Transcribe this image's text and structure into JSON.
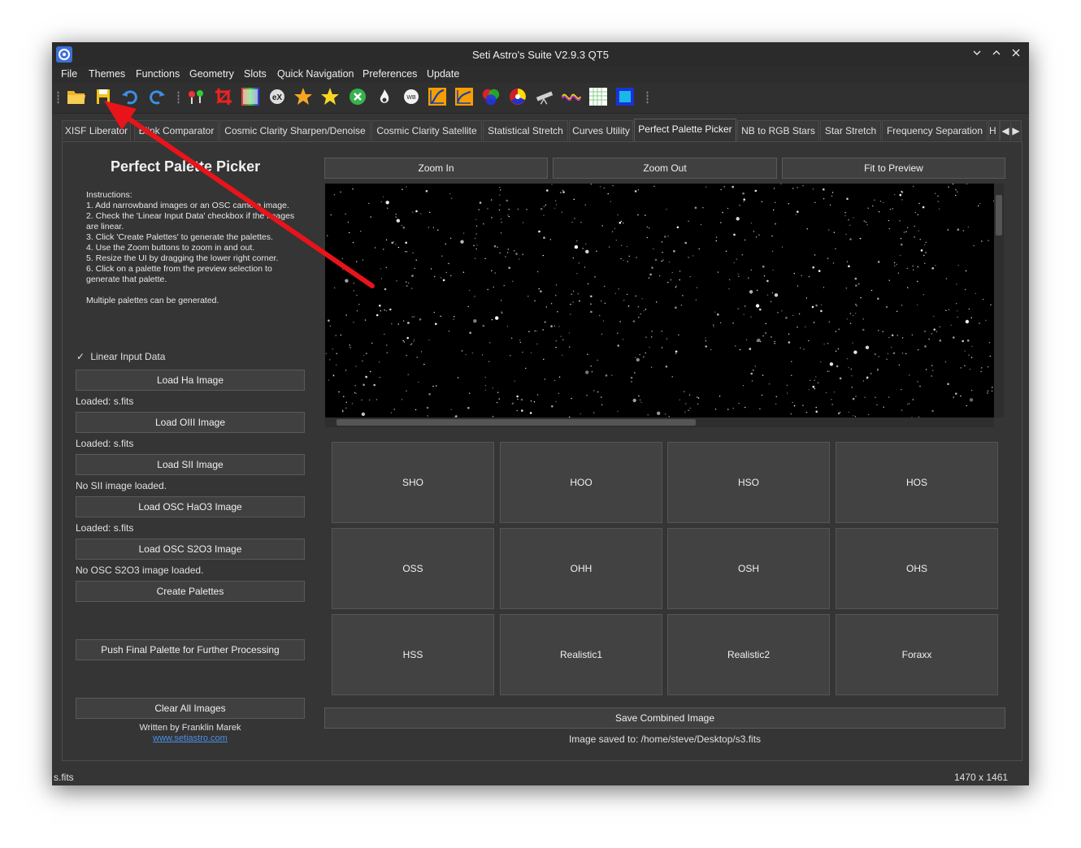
{
  "window": {
    "title": "Seti Astro's Suite V2.9.3 QT5",
    "controls": {
      "minimize": "⌵",
      "maximize": "˄",
      "close": "✕"
    }
  },
  "menu": [
    "File",
    "Themes",
    "Functions",
    "Geometry",
    "Slots",
    "Quick Navigation",
    "Preferences",
    "Update"
  ],
  "toolbar": {
    "icons": [
      "open-folder-icon",
      "save-icon",
      "undo-icon",
      "redo-icon",
      "pin-icon",
      "crop-icon",
      "histogram-icon",
      "exit-icon",
      "star-icon",
      "star-icon",
      "remove-icon",
      "flame-icon",
      "white-balance-icon",
      "curve-icon",
      "curve-icon",
      "rgb-icon",
      "color-wheel-icon",
      "telescope-icon",
      "signal-icon",
      "grid-icon",
      "frame-icon"
    ]
  },
  "tabs": [
    "XISF Liberator",
    "Blink Comparator",
    "Cosmic Clarity Sharpen/Denoise",
    "Cosmic Clarity Satellite",
    "Statistical Stretch",
    "Curves Utility",
    "Perfect Palette Picker",
    "NB to RGB Stars",
    "Star Stretch",
    "Frequency Separation",
    "H"
  ],
  "active_tab": "Perfect Palette Picker",
  "left_panel": {
    "title": "Perfect Palette Picker",
    "instructions": [
      "Instructions:",
      "1. Add narrowband images or an OSC camera image.",
      "2. Check the 'Linear Input Data' checkbox if the images are linear.",
      "3. Click 'Create Palettes' to generate the palettes.",
      "4. Use the Zoom buttons to zoom in and out.",
      "5. Resize the UI by dragging the lower right corner.",
      "6. Click on a palette from the preview selection to generate that palette.",
      "",
      "Multiple palettes can be generated."
    ],
    "checkbox_mark": "✓",
    "checkbox_label": "Linear Input Data",
    "load_ha": "Load Ha Image",
    "ha_status": "Loaded: s.fits",
    "load_oiii": "Load OIII Image",
    "oiii_status": "Loaded: s.fits",
    "load_sii": "Load SII Image",
    "sii_status": "No SII image loaded.",
    "load_osc_hao3": "Load OSC HaO3 Image",
    "osc_hao3_status": "Loaded: s.fits",
    "load_osc_s2o3": "Load OSC S2O3 Image",
    "osc_s2o3_status": "No OSC S2O3 image loaded.",
    "create_palettes": "Create Palettes",
    "push_final": "Push Final Palette for Further Processing",
    "clear_all": "Clear All Images",
    "credit": "Written by Franklin Marek",
    "website": "www.setiastro.com"
  },
  "zoom": {
    "zoom_in": "Zoom In",
    "zoom_out": "Zoom Out",
    "fit": "Fit to Preview"
  },
  "palettes": [
    "SHO",
    "HOO",
    "HSO",
    "HOS",
    "OSS",
    "OHH",
    "OSH",
    "OHS",
    "HSS",
    "Realistic1",
    "Realistic2",
    "Foraxx"
  ],
  "save_button": "Save Combined Image",
  "save_status": "Image saved to: /home/steve/Desktop/s3.fits",
  "status_bar": {
    "file": "s.fits",
    "dimensions": "1470 x 1461"
  },
  "colors": {
    "annotation_arrow": "#e8141a",
    "accent_link": "#4a8fe8",
    "window_bg": "#353535"
  }
}
